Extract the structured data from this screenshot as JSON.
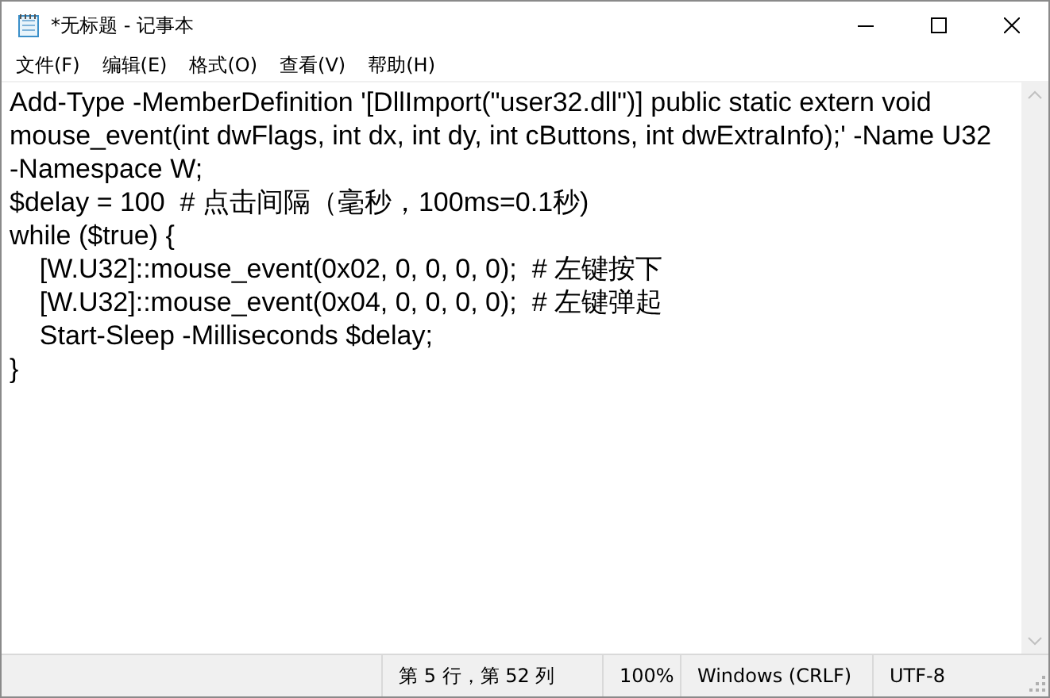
{
  "window": {
    "title": "*无标题 - 记事本"
  },
  "menu": [
    "文件(F)",
    "编辑(E)",
    "格式(O)",
    "查看(V)",
    "帮助(H)"
  ],
  "editor": {
    "lines": [
      "Add-Type -MemberDefinition '[DllImport(\"user32.dll\")] public static extern void",
      "mouse_event(int dwFlags, int dx, int dy, int cButtons, int dwExtraInfo);' -Name U32",
      "-Namespace W;",
      "$delay = 100  # 点击间隔（毫秒，100ms=0.1秒)",
      "while ($true) {",
      "    [W.U32]::mouse_event(0x02, 0, 0, 0, 0);  # 左键按下",
      "    [W.U32]::mouse_event(0x04, 0, 0, 0, 0);  # 左键弹起",
      "    Start-Sleep -Milliseconds $delay;",
      "}"
    ]
  },
  "status_bar": {
    "position": "第 5 行，第 52 列",
    "zoom": "100%",
    "line_ending": "Windows (CRLF)",
    "encoding": "UTF-8"
  }
}
